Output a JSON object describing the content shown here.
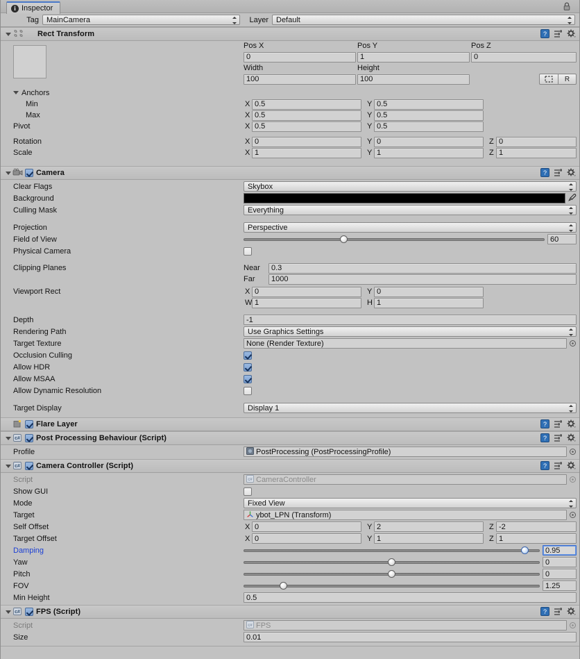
{
  "window": {
    "tab_label": "Inspector",
    "tab_icon": "info-icon",
    "lock_icon": "lock-icon"
  },
  "identity": {
    "tag_label": "Tag",
    "tag_value": "MainCamera",
    "layer_label": "Layer",
    "layer_value": "Default"
  },
  "header_icons": {
    "help": "help-icon",
    "preset": "preset-icon",
    "settings": "gear-icon"
  },
  "components": [
    {
      "id": "rect-transform",
      "title": "Rect Transform",
      "icon": "rect-transform-icon",
      "has_checkbox": false,
      "expanded": true
    },
    {
      "id": "camera",
      "title": "Camera",
      "icon": "camera-icon",
      "has_checkbox": true,
      "enabled": true,
      "expanded": true
    },
    {
      "id": "flare-layer",
      "title": "Flare Layer",
      "icon": "flare-layer-icon",
      "has_checkbox": true,
      "enabled": true,
      "expanded": false
    },
    {
      "id": "post-processing-behaviour",
      "title": "Post Processing Behaviour (Script)",
      "icon": "csharp-script-icon",
      "has_checkbox": true,
      "enabled": true,
      "expanded": true
    },
    {
      "id": "camera-controller",
      "title": "Camera Controller (Script)",
      "icon": "csharp-script-icon",
      "has_checkbox": true,
      "enabled": true,
      "expanded": true
    },
    {
      "id": "fps",
      "title": "FPS (Script)",
      "icon": "csharp-script-icon",
      "has_checkbox": true,
      "enabled": true,
      "expanded": true
    }
  ],
  "rect_transform": {
    "col_pos_x": "Pos X",
    "col_pos_y": "Pos Y",
    "col_pos_z": "Pos Z",
    "pos_x": "0",
    "pos_y": "1",
    "pos_z": "0",
    "col_width": "Width",
    "col_height": "Height",
    "width": "100",
    "height": "100",
    "anchor_preset_button": "anchor-preset-icon",
    "raw_button": "R",
    "anchors_label": "Anchors",
    "min_label": "Min",
    "max_label": "Max",
    "pivot_label": "Pivot",
    "rotation_label": "Rotation",
    "scale_label": "Scale",
    "axis_x": "X",
    "axis_y": "Y",
    "axis_z": "Z",
    "min_x": "0.5",
    "min_y": "0.5",
    "max_x": "0.5",
    "max_y": "0.5",
    "pivot_x": "0.5",
    "pivot_y": "0.5",
    "rot_x": "0",
    "rot_y": "0",
    "rot_z": "0",
    "scale_x": "1",
    "scale_y": "1",
    "scale_z": "1"
  },
  "camera": {
    "clear_flags_label": "Clear Flags",
    "clear_flags_value": "Skybox",
    "background_label": "Background",
    "background_color": "#000000",
    "eyedropper_icon": "eyedropper-icon",
    "culling_mask_label": "Culling Mask",
    "culling_mask_value": "Everything",
    "projection_label": "Projection",
    "projection_value": "Perspective",
    "fov_label": "Field of View",
    "fov_value": "60",
    "fov_fraction": 0.333,
    "physical_camera_label": "Physical Camera",
    "physical_camera_checked": false,
    "clipping_planes_label": "Clipping Planes",
    "near_label": "Near",
    "near_value": "0.3",
    "far_label": "Far",
    "far_value": "1000",
    "viewport_rect_label": "Viewport Rect",
    "vp_x_label": "X",
    "vp_x": "0",
    "vp_y_label": "Y",
    "vp_y": "0",
    "vp_w_label": "W",
    "vp_w": "1",
    "vp_h_label": "H",
    "vp_h": "1",
    "depth_label": "Depth",
    "depth_value": "-1",
    "rendering_path_label": "Rendering Path",
    "rendering_path_value": "Use Graphics Settings",
    "target_texture_label": "Target Texture",
    "target_texture_value": "None (Render Texture)",
    "occlusion_culling_label": "Occlusion Culling",
    "occlusion_culling_checked": true,
    "allow_hdr_label": "Allow HDR",
    "allow_hdr_checked": true,
    "allow_msaa_label": "Allow MSAA",
    "allow_msaa_checked": true,
    "allow_dynres_label": "Allow Dynamic Resolution",
    "allow_dynres_checked": false,
    "target_display_label": "Target Display",
    "target_display_value": "Display 1"
  },
  "post_processing": {
    "profile_label": "Profile",
    "profile_value": "PostProcessing (PostProcessingProfile)",
    "profile_icon": "profile-asset-icon"
  },
  "camera_controller": {
    "script_label": "Script",
    "script_value": "CameraController",
    "show_gui_label": "Show GUI",
    "show_gui_checked": false,
    "mode_label": "Mode",
    "mode_value": "Fixed View",
    "target_label": "Target",
    "target_value": "ybot_LPN (Transform)",
    "target_icon": "transform-asset-icon",
    "self_offset_label": "Self Offset",
    "self_offset_x": "0",
    "self_offset_y": "2",
    "self_offset_z": "-2",
    "target_offset_label": "Target Offset",
    "target_offset_x": "0",
    "target_offset_y": "1",
    "target_offset_z": "1",
    "axis_x": "X",
    "axis_y": "Y",
    "axis_z": "Z",
    "damping_label": "Damping",
    "damping_value": "0.95",
    "damping_fraction": 0.95,
    "yaw_label": "Yaw",
    "yaw_value": "0",
    "yaw_fraction": 0.5,
    "pitch_label": "Pitch",
    "pitch_value": "0",
    "pitch_fraction": 0.5,
    "fov_label": "FOV",
    "fov_value": "1.25",
    "fov_fraction": 0.135,
    "min_height_label": "Min Height",
    "min_height_value": "0.5"
  },
  "fps": {
    "script_label": "Script",
    "script_value": "FPS",
    "size_label": "Size",
    "size_value": "0.01"
  },
  "colors": {
    "panel_bg": "#c2c2c2",
    "field_bg": "#d2d2d2",
    "accent_blue": "#1b3fd4",
    "checkbox_on": "#7ba0d2",
    "tab_accent": "#4a78c8"
  }
}
